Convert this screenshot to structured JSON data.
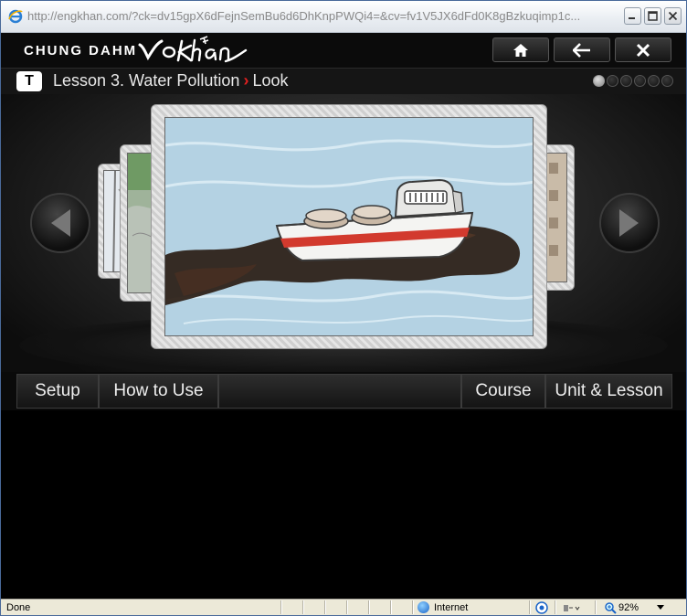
{
  "window": {
    "url": "http://engkhan.com/?ck=dv15gpX6dFejnSemBu6d6DhKnpPWQi4=&cv=fv1V5JX6dFd0K8gBzkuqimp1c...",
    "controls": [
      "minimize-icon",
      "maximize-icon",
      "close-icon"
    ]
  },
  "header": {
    "brand": "CHUNG DAHM",
    "logo_text": "voKhan",
    "buttons": [
      "home-icon",
      "back-arrow-icon",
      "close-icon"
    ]
  },
  "lesson": {
    "badge": "T",
    "title": "Lesson 3. Water Pollution",
    "separator": "›",
    "section": "Look",
    "page_count": 6,
    "active_page": 1
  },
  "carousel": {
    "slide_count": 5,
    "active_slide_description": "oil-spill-boat-illustration"
  },
  "menu": {
    "setup": "Setup",
    "how_to_use": "How to Use",
    "course": "Course",
    "unit_lesson": "Unit & Lesson"
  },
  "status": {
    "text": "Done",
    "zone": "Internet",
    "zoom": "92%"
  },
  "colors": {
    "accent_red": "#e02020",
    "sea": "#aacbde",
    "oil": "#2a1c14"
  }
}
